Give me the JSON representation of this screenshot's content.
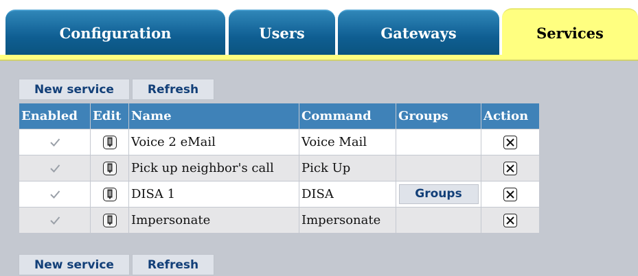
{
  "tabs": [
    {
      "label": "Configuration",
      "active": false
    },
    {
      "label": "Users",
      "active": false
    },
    {
      "label": "Gateways",
      "active": false
    },
    {
      "label": "Services",
      "active": true
    }
  ],
  "toolbar": {
    "new_service_label": "New service",
    "refresh_label": "Refresh"
  },
  "table": {
    "headers": {
      "enabled": "Enabled",
      "edit": "Edit",
      "name": "Name",
      "command": "Command",
      "groups": "Groups",
      "action": "Action"
    },
    "rows": [
      {
        "enabled": true,
        "name": "Voice 2 eMail",
        "command": "Voice Mail",
        "groups_button": ""
      },
      {
        "enabled": true,
        "name": "Pick up neighbor's call",
        "command": "Pick Up",
        "groups_button": ""
      },
      {
        "enabled": true,
        "name": "DISA 1",
        "command": "DISA",
        "groups_button": "Groups"
      },
      {
        "enabled": true,
        "name": "Impersonate",
        "command": "Impersonate",
        "groups_button": ""
      }
    ]
  },
  "icons": {
    "enabled": "check-icon",
    "edit": "edit-icon",
    "delete": "delete-icon"
  },
  "colors": {
    "tab_blue": "#0f5e92",
    "active_tab": "#ffff80",
    "header_blue": "#3f82b8",
    "button_text": "#123f78",
    "background": "#c4c8d0"
  }
}
